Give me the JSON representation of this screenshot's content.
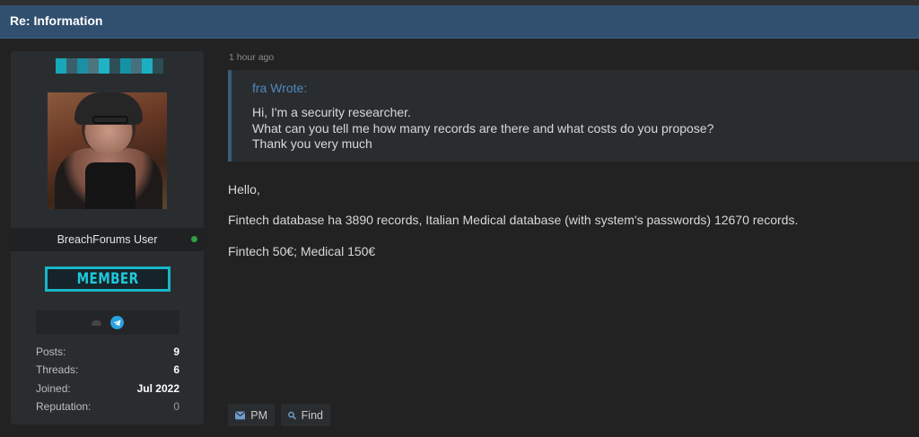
{
  "header": {
    "title": "Re: Information"
  },
  "profile": {
    "username_colors": [
      "#17a7b8",
      "#3a5f6b",
      "#1b8fa3",
      "#4d7580",
      "#1fb3c5",
      "#2f4f58",
      "#1493a6",
      "#46707c",
      "#1ab0c2",
      "#2b4c55"
    ],
    "group": "BreachForums User",
    "online_color": "#2ea043",
    "rank": "MEMBER",
    "contact_icons": [
      "hat-icon",
      "telegram-icon"
    ],
    "stats": [
      {
        "label": "Posts:",
        "value": "9"
      },
      {
        "label": "Threads:",
        "value": "6"
      },
      {
        "label": "Joined:",
        "value": "Jul 2022"
      },
      {
        "label": "Reputation:",
        "value": "0"
      }
    ]
  },
  "post": {
    "time": "1 hour ago",
    "quote": {
      "author": "fra Wrote:",
      "lines": [
        "Hi, I'm a security researcher.",
        "What can you tell me how many records are there and what costs do you propose?",
        "Thank you very much"
      ]
    },
    "message": [
      "Hello,",
      "Fintech database ha 3890 records, Italian Medical database (with system's passwords) 12670 records.",
      "Fintech 50€; Medical 150€"
    ],
    "buttons": {
      "pm": "PM",
      "find": "Find"
    }
  },
  "colors": {
    "header_bg": "#31506f",
    "accent": "#1fc9db",
    "link": "#4f87bd",
    "page_bg": "#222222"
  }
}
